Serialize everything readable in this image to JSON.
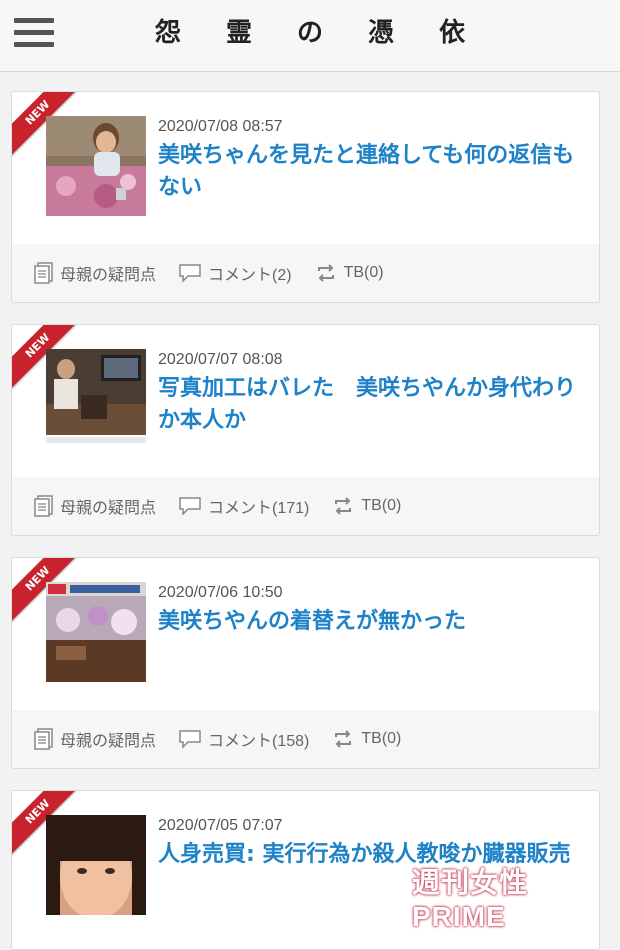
{
  "header": {
    "title": "怨 霊 の 憑 依",
    "menu_icon": "hamburger-menu-icon"
  },
  "posts": [
    {
      "badge": "NEW",
      "date": "2020/07/08 08:57",
      "title": "美咲ちゃんを見たと連絡しても何の返信もない",
      "category": "母親の疑問点",
      "comments": "コメント(2)",
      "tb": "TB(0)"
    },
    {
      "badge": "NEW",
      "date": "2020/07/07 08:08",
      "title": "写真加工はバレた　美咲ちやんか身代わりか本人か",
      "category": "母親の疑問点",
      "comments": "コメント(171)",
      "tb": "TB(0)"
    },
    {
      "badge": "NEW",
      "date": "2020/07/06 10:50",
      "title": "美咲ちやんの着替えが無かった",
      "category": "母親の疑問点",
      "comments": "コメント(158)",
      "tb": "TB(0)"
    },
    {
      "badge": "NEW",
      "date": "2020/07/05 07:07",
      "title": "人身売買: 実行行為か殺人教唆か臓器販売",
      "category": "",
      "comments": "",
      "tb": ""
    }
  ],
  "watermark": "週刊女性PRIME",
  "colors": {
    "title_link": "#1e82c8",
    "ribbon": "#c8222d"
  }
}
